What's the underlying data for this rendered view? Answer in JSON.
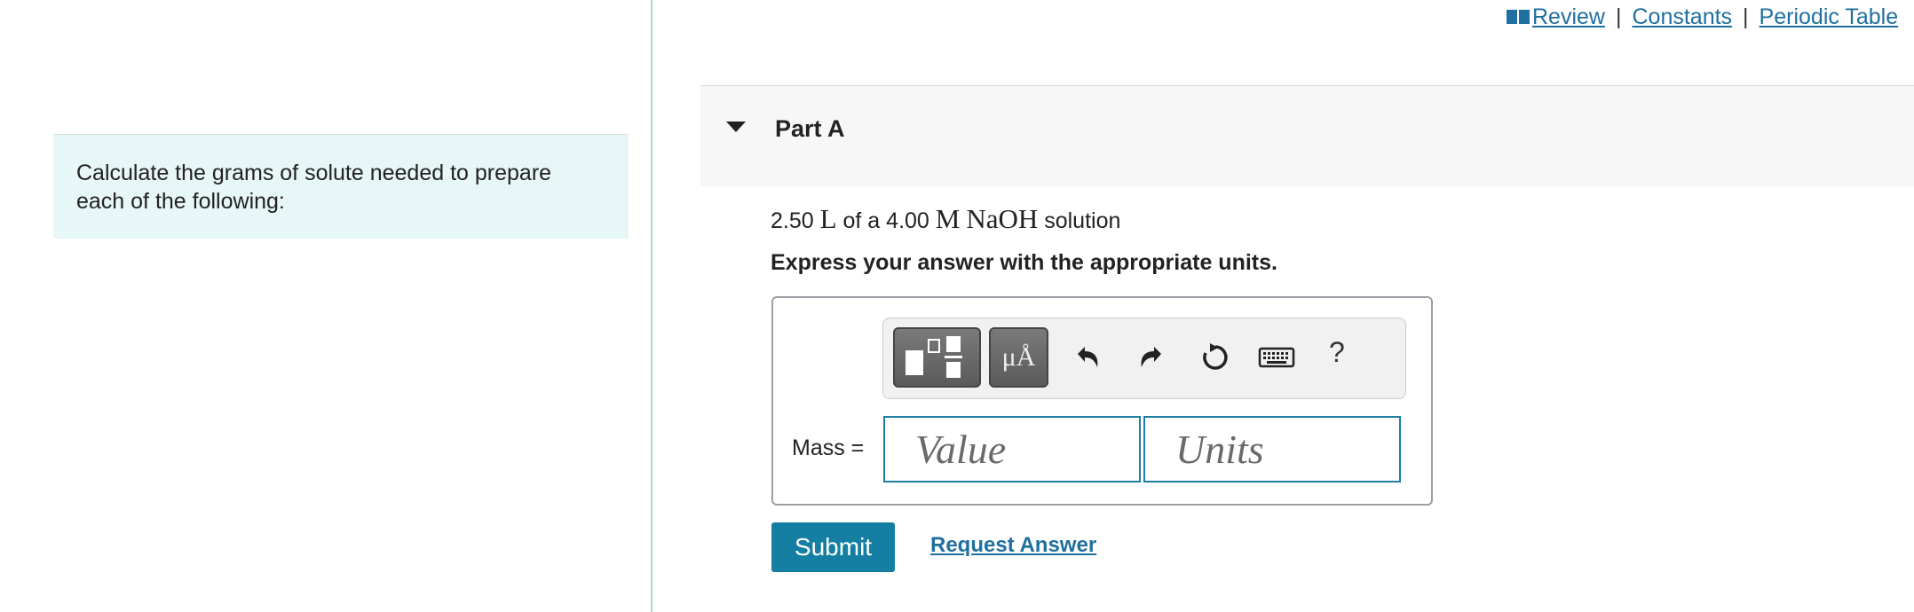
{
  "intro": {
    "text": "Calculate the grams of solute needed to prepare each of the following:"
  },
  "top_links": {
    "review": "Review",
    "separator": "|",
    "constants": "Constants",
    "periodic_table": "Periodic Table"
  },
  "part": {
    "title": "Part A"
  },
  "question": {
    "volume": "2.50",
    "volume_unit": "L",
    "of_a": "of a",
    "molarity": "4.00",
    "molarity_unit": "M",
    "solute": "NaOH",
    "suffix": "solution"
  },
  "instruction": "Express your answer with the appropriate units.",
  "toolbar": {
    "units_symbol": "μÅ",
    "help": "?"
  },
  "answer": {
    "mass_label": "Mass =",
    "value_placeholder": "Value",
    "units_placeholder": "Units"
  },
  "actions": {
    "submit_label": "Submit",
    "request_answer_label": "Request Answer"
  },
  "colors": {
    "accent": "#147fa3",
    "link": "#1f6f9f",
    "intro_bg": "#e7f6f6"
  }
}
